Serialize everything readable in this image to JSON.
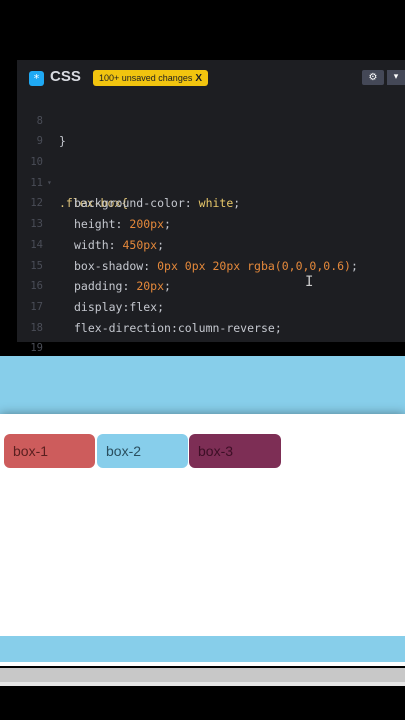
{
  "editor": {
    "title": "CSS",
    "icon": "*",
    "unsaved_badge": "100+ unsaved changes",
    "unsaved_close": "X",
    "settings_icon": "⚙",
    "chevron_icon": "▾"
  },
  "code": {
    "lines": [
      {
        "num": "8",
        "text": "}"
      },
      {
        "num": "9",
        "text": ""
      },
      {
        "num": "10",
        "text": ".flex-box{"
      },
      {
        "num": "11",
        "prop": "background-color",
        "value": "white"
      },
      {
        "num": "12",
        "prop": "height",
        "value": "200px"
      },
      {
        "num": "13",
        "prop": "width",
        "value": "450px"
      },
      {
        "num": "14",
        "prop": "box-shadow",
        "value": "0px 0px 20px rgba(0,0,0,0.6)"
      },
      {
        "num": "15",
        "prop": "padding",
        "value": "20px"
      },
      {
        "num": "16",
        "prop": "display",
        "value": "flex"
      },
      {
        "num": "17",
        "prop": "flex-direction",
        "value": "column-reverse"
      },
      {
        "num": "18",
        "text": ""
      },
      {
        "num": "19",
        "text": ""
      }
    ]
  },
  "preview": {
    "boxes": [
      "box-1",
      "box-2",
      "box-3"
    ]
  },
  "colors": {
    "editor_bg": "#1d1e22",
    "badge": "#f1c40f",
    "number": "#e5893b",
    "box1": "#cd5c5c",
    "box2": "#87ceeb",
    "box3": "#7d2e55",
    "band": "#87ceea"
  }
}
